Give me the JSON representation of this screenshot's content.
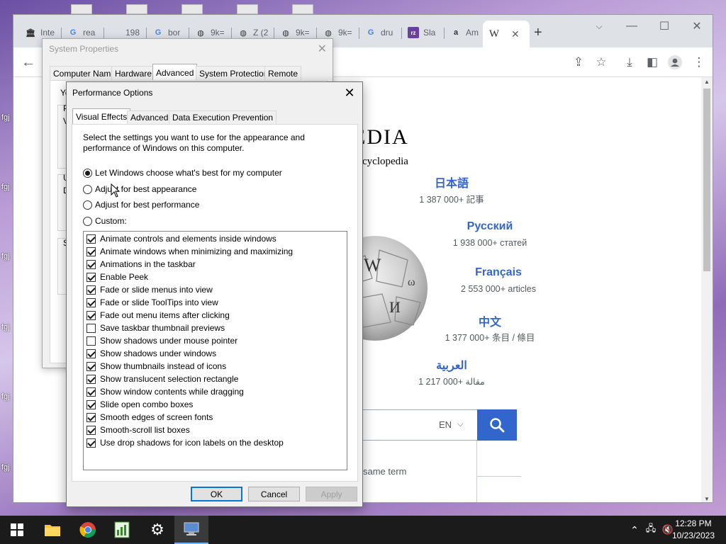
{
  "desktop": {
    "fragments": [
      "fgj",
      "fgj",
      "fgj",
      "fgj",
      "fgj",
      "fgj"
    ]
  },
  "browser": {
    "tabs": [
      {
        "icon": "museum-icon",
        "label": "Inte"
      },
      {
        "icon": "google-icon",
        "label": "rea"
      },
      {
        "icon": "blank-icon",
        "label": "198"
      },
      {
        "icon": "google-icon",
        "label": "bor"
      },
      {
        "icon": "globe-icon",
        "label": "9k="
      },
      {
        "icon": "globe-icon",
        "label": "Z (2"
      },
      {
        "icon": "globe-icon",
        "label": "9k="
      },
      {
        "icon": "globe-icon",
        "label": "9k="
      },
      {
        "icon": "google-icon",
        "label": "dru"
      },
      {
        "icon": "rz-icon",
        "label": "Sla"
      },
      {
        "icon": "amazon-icon",
        "label": "Am"
      },
      {
        "icon": "wikipedia-icon",
        "label": ""
      }
    ],
    "new_tab": "+",
    "wiki": {
      "wordmark": "EDIA",
      "tagline": "cyclopedia",
      "languages": [
        {
          "name": "日本語",
          "count": "1 387 000+ 記事"
        },
        {
          "name": "Русский",
          "count": "1 938 000+ статей"
        },
        {
          "name": "Français",
          "count": "2 553 000+ articles"
        },
        {
          "name": "中文",
          "count": "1 377 000+ 条目 / 條目"
        },
        {
          "name": "العربية",
          "count": "1 217 000+ مقالة"
        }
      ],
      "search_lang": "EN",
      "suggestion": "same term"
    }
  },
  "sysprops": {
    "title": "System Properties",
    "tabs": [
      "Computer Name",
      "Hardware",
      "Advanced",
      "System Protection",
      "Remote"
    ],
    "fragments": [
      "Yo",
      "P",
      "V",
      "U",
      "D",
      "S"
    ]
  },
  "perf": {
    "title": "Performance Options",
    "tabs": [
      "Visual Effects",
      "Advanced",
      "Data Execution Prevention"
    ],
    "description": "Select the settings you want to use for the appearance and performance of Windows on this computer.",
    "options": [
      {
        "label": "Let Windows choose what's best for my computer",
        "selected": true
      },
      {
        "label": "Adjust for best appearance",
        "selected": false
      },
      {
        "label": "Adjust for best performance",
        "selected": false
      },
      {
        "label": "Custom:",
        "selected": false
      }
    ],
    "effects": [
      {
        "label": "Animate controls and elements inside windows",
        "checked": true
      },
      {
        "label": "Animate windows when minimizing and maximizing",
        "checked": true
      },
      {
        "label": "Animations in the taskbar",
        "checked": true
      },
      {
        "label": "Enable Peek",
        "checked": true
      },
      {
        "label": "Fade or slide menus into view",
        "checked": true
      },
      {
        "label": "Fade or slide ToolTips into view",
        "checked": true
      },
      {
        "label": "Fade out menu items after clicking",
        "checked": true
      },
      {
        "label": "Save taskbar thumbnail previews",
        "checked": false
      },
      {
        "label": "Show shadows under mouse pointer",
        "checked": false
      },
      {
        "label": "Show shadows under windows",
        "checked": true
      },
      {
        "label": "Show thumbnails instead of icons",
        "checked": true
      },
      {
        "label": "Show translucent selection rectangle",
        "checked": true
      },
      {
        "label": "Show window contents while dragging",
        "checked": true
      },
      {
        "label": "Slide open combo boxes",
        "checked": true
      },
      {
        "label": "Smooth edges of screen fonts",
        "checked": true
      },
      {
        "label": "Smooth-scroll list boxes",
        "checked": true
      },
      {
        "label": "Use drop shadows for icon labels on the desktop",
        "checked": true
      }
    ],
    "buttons": {
      "ok": "OK",
      "cancel": "Cancel",
      "apply": "Apply"
    }
  },
  "taskbar": {
    "apps": [
      "windows-start-icon",
      "file-explorer-icon",
      "chrome-icon",
      "spreadsheet-icon",
      "settings-gear-icon",
      "system-properties-icon"
    ],
    "time": "12:28 PM",
    "date": "10/23/2023"
  }
}
